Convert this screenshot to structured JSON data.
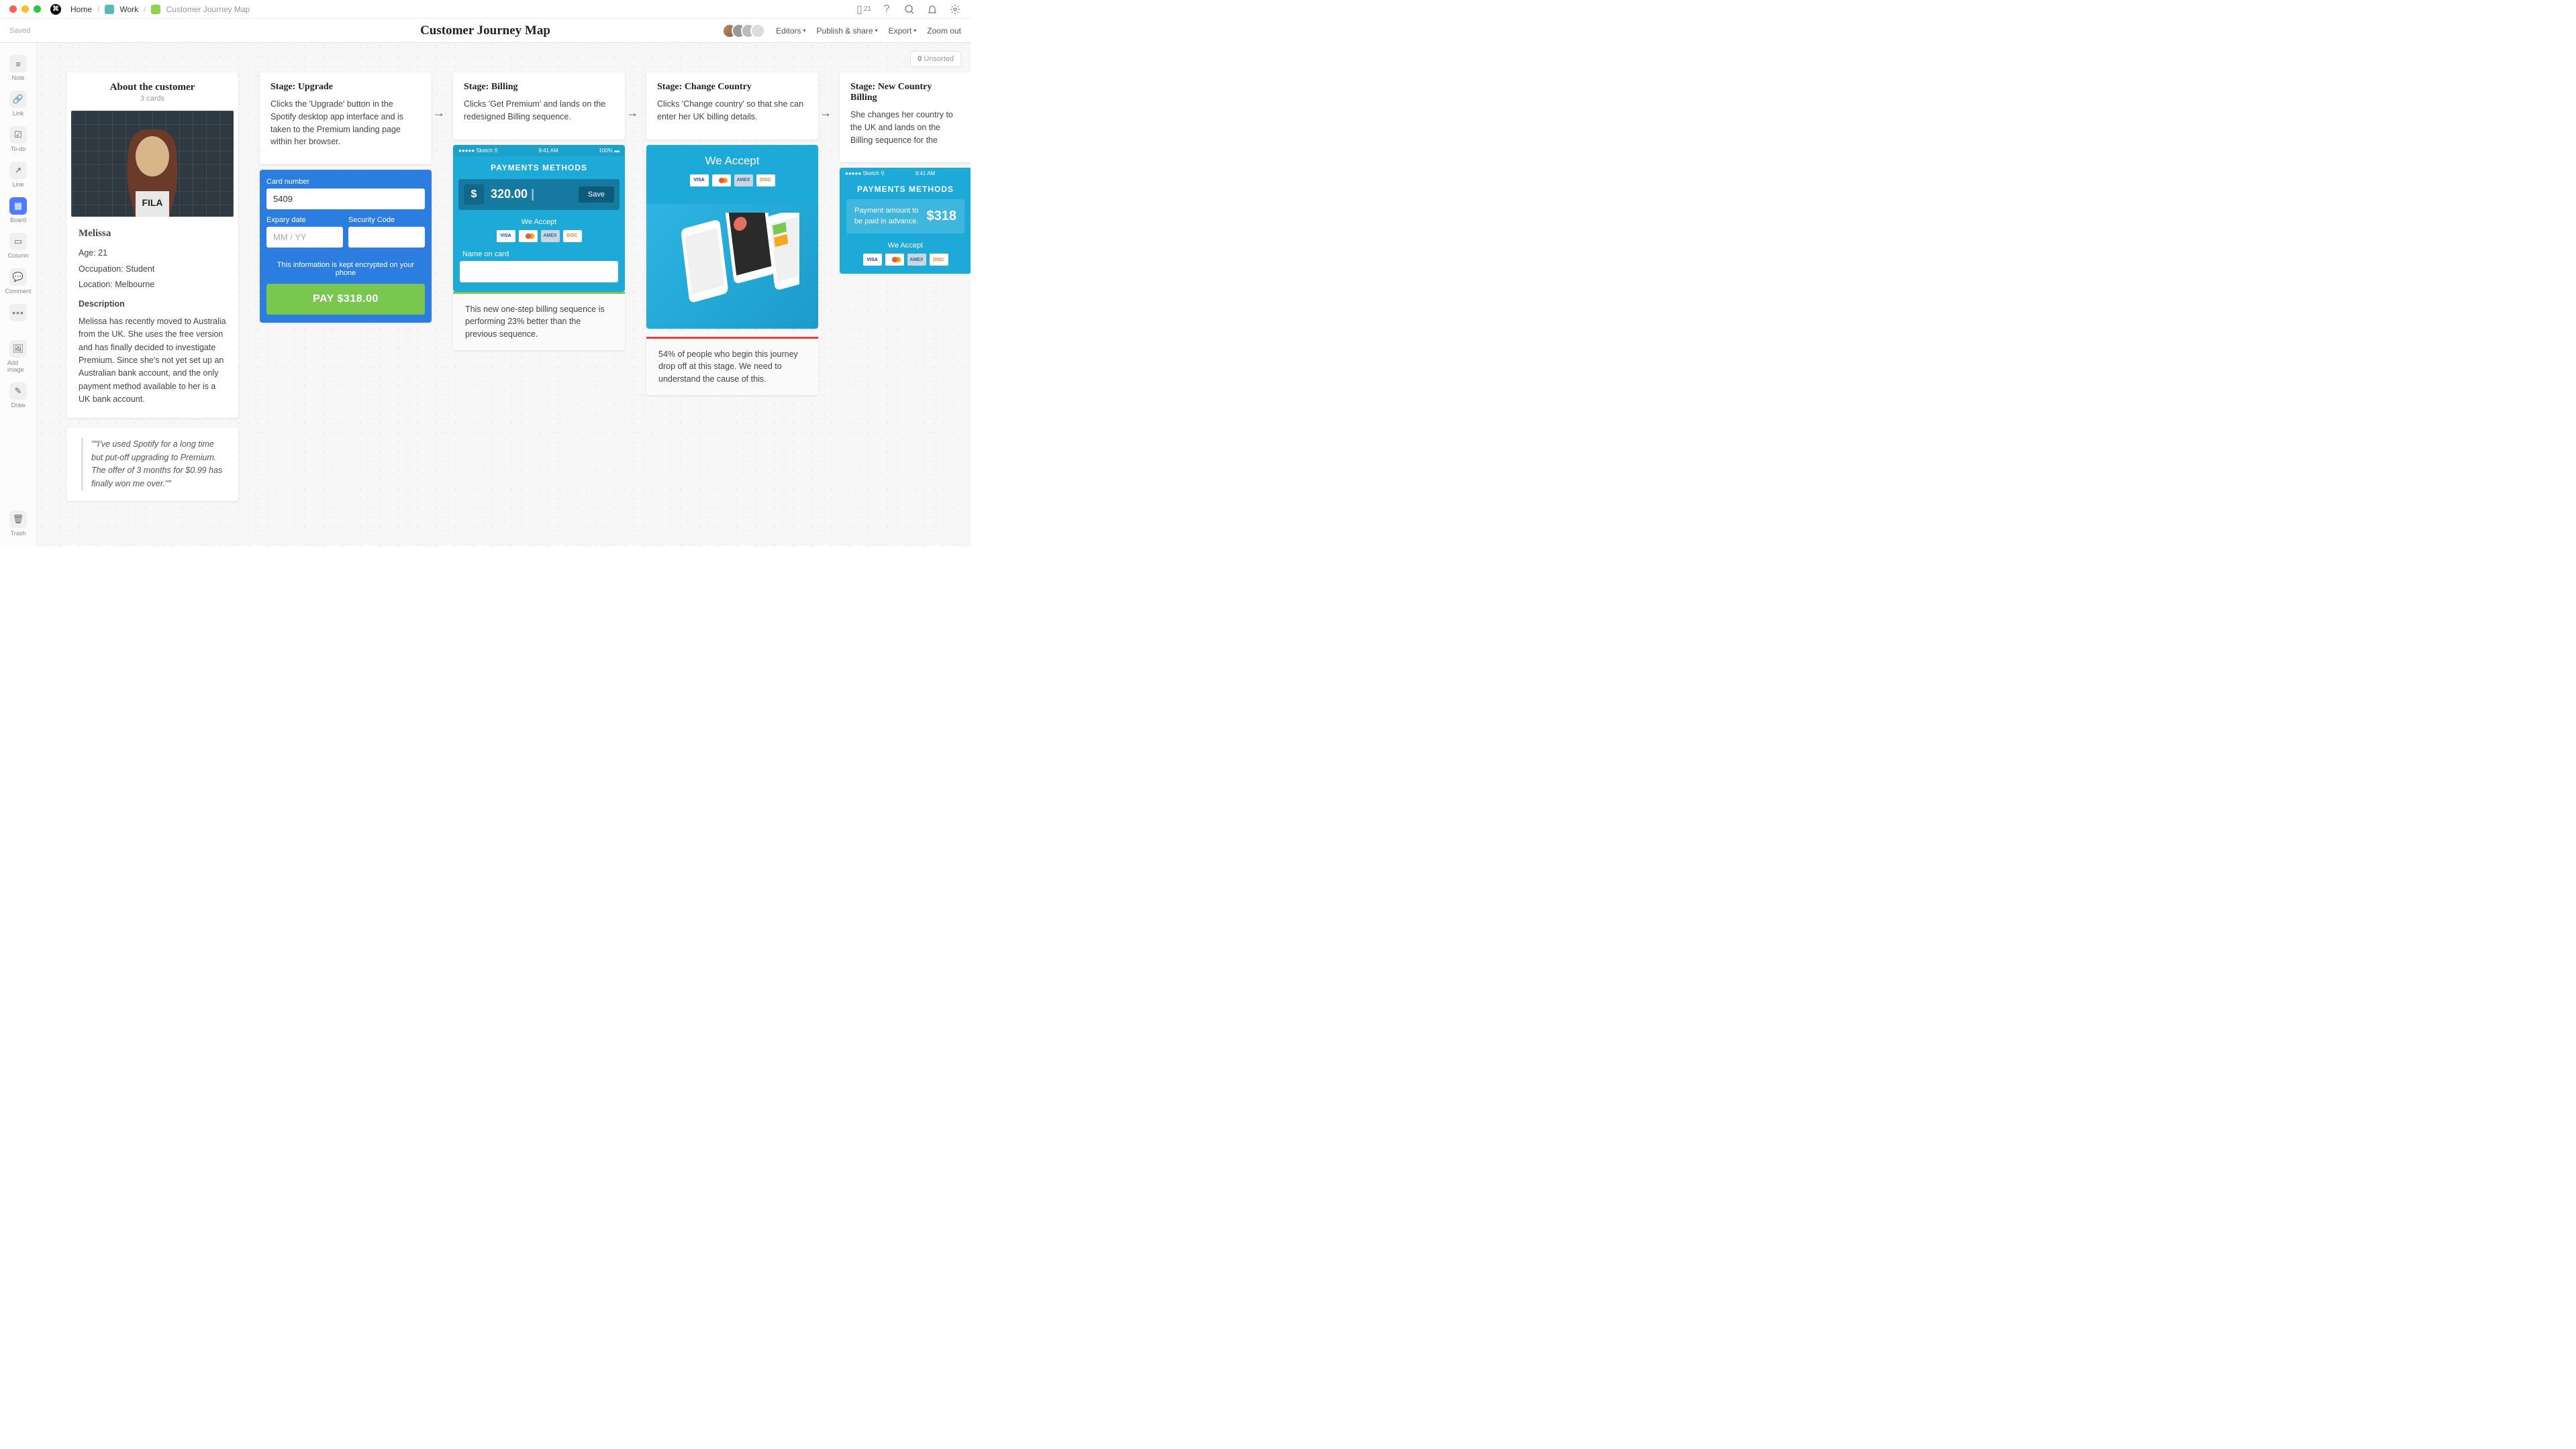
{
  "titlebar": {
    "home": "Home",
    "work": "Work",
    "page": "Customer Journey Map",
    "device_count": "21"
  },
  "header": {
    "saved": "Saved",
    "title": "Customer Journey Map",
    "editors": "Editors",
    "publish": "Publish & share",
    "export": "Export",
    "zoom": "Zoom out"
  },
  "sidebar": {
    "items": [
      {
        "label": "Note"
      },
      {
        "label": "Link"
      },
      {
        "label": "To-do"
      },
      {
        "label": "Line"
      },
      {
        "label": "Board"
      },
      {
        "label": "Column"
      },
      {
        "label": "Comment"
      }
    ],
    "add_image": "Add image",
    "draw": "Draw",
    "trash": "Trash"
  },
  "unsorted": {
    "count": "0",
    "label": "Unsorted"
  },
  "about": {
    "title": "About the customer",
    "sub": "3 cards",
    "name": "Melissa",
    "age": "Age: 21",
    "occupation": "Occupation: Student",
    "location": "Location: Melbourne",
    "desc_label": "Description",
    "desc": "Melissa has recently moved to Australia from the UK. She uses the free version and has finally decided to investigate Premium. Since she's not yet set up an Australian bank account, and the only payment method available to her is a UK bank account.",
    "quote": "\"\"I've used Spotify for a long time but put-off upgrading to Premium. The offer of 3 months for $0.99 has finally won me over.\"\""
  },
  "stages": [
    {
      "title": "Stage: Upgrade",
      "desc": "Clicks the 'Upgrade' button in the Spotify desktop app interface and is taken to the Premium landing page within her browser.",
      "mock": {
        "card_label": "Card number",
        "card_value": "5409",
        "expiry_label": "Expary date",
        "expiry_ph": "MM / YY",
        "cvc_label": "Security Code",
        "enc": "This information is kept encrypted on your phone",
        "pay": "PAY $318.00"
      }
    },
    {
      "title": "Stage: Billing",
      "desc": "Clicks 'Get Premium' and lands on the redesigned Billing sequence.",
      "mock": {
        "status_l": "●●●●● Sketch ⚲",
        "status_c": "9:41 AM",
        "status_r": "100% ▬",
        "heading": "PAYMENTS METHODS",
        "currency": "$",
        "amount": "320.00",
        "save": "Save",
        "accept": "We Accept",
        "name_label": "Name on card"
      },
      "note": "This new one-step billing sequence is performing 23% better than the previous sequence."
    },
    {
      "title": "Stage: Change Country",
      "desc": "Clicks 'Change country' so that she can enter her UK billing details.",
      "mock": {
        "accept": "We Accept"
      },
      "note": "54% of people who begin this journey drop off at this stage. We need to understand the cause of this."
    },
    {
      "title": "Stage: New Country Billing",
      "desc": "She changes her country to the UK and lands on the Billing sequence for the",
      "mock": {
        "status_l": "●●●●● Sketch ⚲",
        "status_c": "9:41 AM",
        "heading": "PAYMENTS METHODS",
        "adv_txt": "Payment amount to be paid in advance.",
        "adv_amt": "$318",
        "accept": "We Accept"
      }
    }
  ]
}
